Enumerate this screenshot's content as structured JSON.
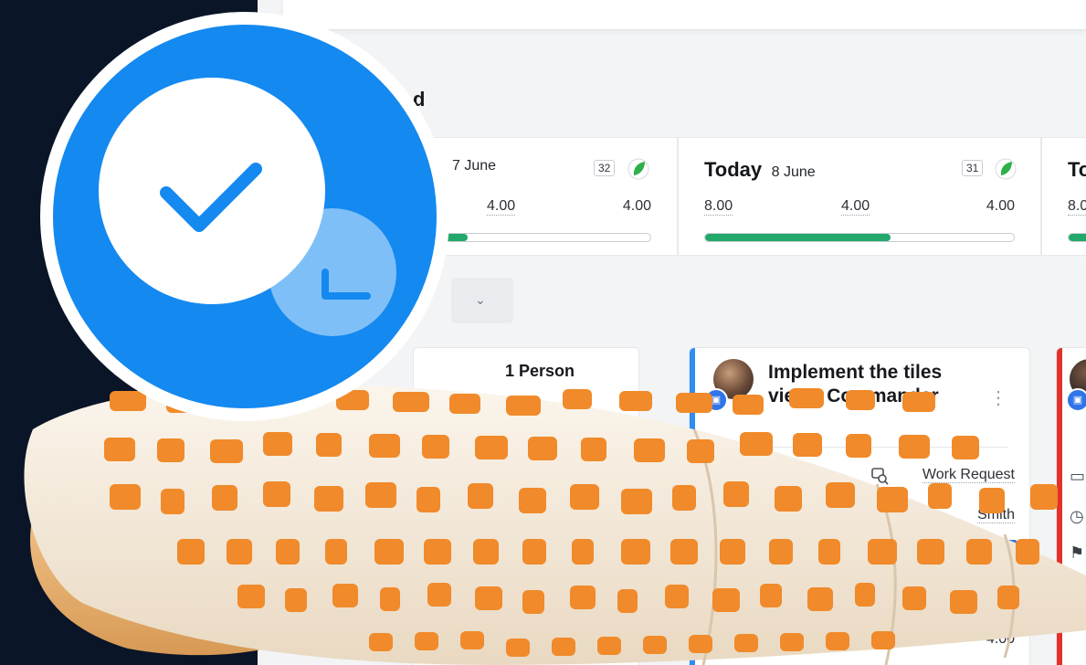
{
  "section": {
    "title": "d"
  },
  "days": [
    {
      "label": "",
      "date": "7 June",
      "count": "32",
      "n1": "",
      "n2": "4.00",
      "n3": "4.00",
      "progress": 0.5
    },
    {
      "label": "Today",
      "date": "8 June",
      "count": "31",
      "n1": "8.00",
      "n2": "4.00",
      "n3": "4.00",
      "progress": 0.6
    },
    {
      "label": "To",
      "date": "",
      "count": "",
      "n1": "8.0",
      "n2": "",
      "n3": "",
      "progress": 0.3
    }
  ],
  "filter": {
    "chevron": "⌄"
  },
  "tasks": [
    {
      "title": "",
      "partial_title": "1 Person",
      "accent": "#ffffff",
      "meta_type": "",
      "meta_person": ""
    },
    {
      "title": "Implement the tiles view - Commander",
      "accent": "#2f8df2",
      "meta_type": "Work Request",
      "meta_person": "Smith",
      "meta_hours": "4.00"
    },
    {
      "title": "",
      "accent": "#e0322b"
    }
  ],
  "colors": {
    "progress": "#22a86b",
    "brand_blue": "#1489f0",
    "clock_blue": "#7fbff8",
    "shell_orange": "#f08a2a"
  },
  "icons": [
    "check-icon",
    "clock-icon",
    "leaf-icon",
    "work-request-icon",
    "more-icon",
    "folder-icon",
    "flag-icon"
  ]
}
